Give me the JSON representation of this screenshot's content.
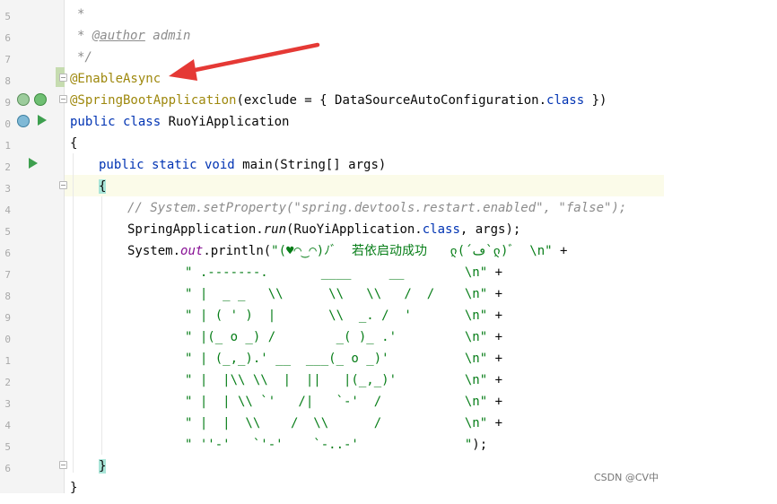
{
  "gutter": {
    "line_numbers": [
      "5",
      "6",
      "7",
      "8",
      "9",
      "0",
      "1",
      "2",
      "3",
      "4",
      "5",
      "6",
      "7",
      "8",
      "9",
      "0",
      "1",
      "2",
      "3",
      "4",
      "5",
      "6"
    ]
  },
  "code": {
    "l1": "*",
    "l2_pre": "* ",
    "l2_tag": "@author",
    "l2_post": " admin",
    "l3": "*/",
    "l4": "@EnableAsync",
    "l5_ann": "@SpringBootApplication",
    "l5_a": "(exclude = { DataSourceAutoConfiguration.",
    "l5_kw": "class",
    "l5_b": " })",
    "l6_kw": "public class",
    "l6_name": " RuoYiApplication",
    "l7": "{",
    "l8_kw": "public static void",
    "l8_name": " main",
    "l8_rest": "(String[] args)",
    "l9": "{",
    "l10": "// System.setProperty(\"spring.devtools.restart.enabled\", \"false\");",
    "l11_a": "SpringApplication.",
    "l11_run": "run",
    "l11_b": "(RuoYiApplication.",
    "l11_kw": "class",
    "l11_c": ", args);",
    "l12_a": "System.",
    "l12_out": "out",
    "l12_b": ".println(",
    "l12_str": "\"(♥◠‿◠)ﾉﾞ  若依启动成功   ლ(´ڡ`ლ)ﾞ  \\n\"",
    "l12_plus": " +",
    "ascii": [
      {
        "str": "\" .-------.       ____     __        \\n\"",
        "op": " +"
      },
      {
        "str": "\" |  _ _   \\\\      \\\\   \\\\   /  /    \\n\"",
        "op": " +"
      },
      {
        "str": "\" | ( ' )  |       \\\\  _. /  '       \\n\"",
        "op": " +"
      },
      {
        "str": "\" |(_ o _) /        _( )_ .'         \\n\"",
        "op": " +"
      },
      {
        "str": "\" | (_,_).' __  ___(_ o _)'          \\n\"",
        "op": " +"
      },
      {
        "str": "\" |  |\\\\ \\\\  |  ||   |(_,_)'         \\n\"",
        "op": " +"
      },
      {
        "str": "\" |  | \\\\ `'   /|   `-'  /           \\n\"",
        "op": " +"
      },
      {
        "str": "\" |  |  \\\\    /  \\\\      /           \\n\"",
        "op": " +"
      },
      {
        "str": "\" ''-'   `'-'    `-..-'              \"",
        "op": ");"
      }
    ],
    "l22": "}",
    "l23": "}"
  },
  "icons": [
    "run-icon",
    "debug-icon",
    "spring-bean-icon"
  ],
  "colors": {
    "keyword": "#0033b3",
    "annotation": "#9e880d",
    "string": "#067d17",
    "comment": "#8c8c8c",
    "static_field": "#871094",
    "arrow": "#e53935"
  },
  "watermark": "CSDN @CV中"
}
